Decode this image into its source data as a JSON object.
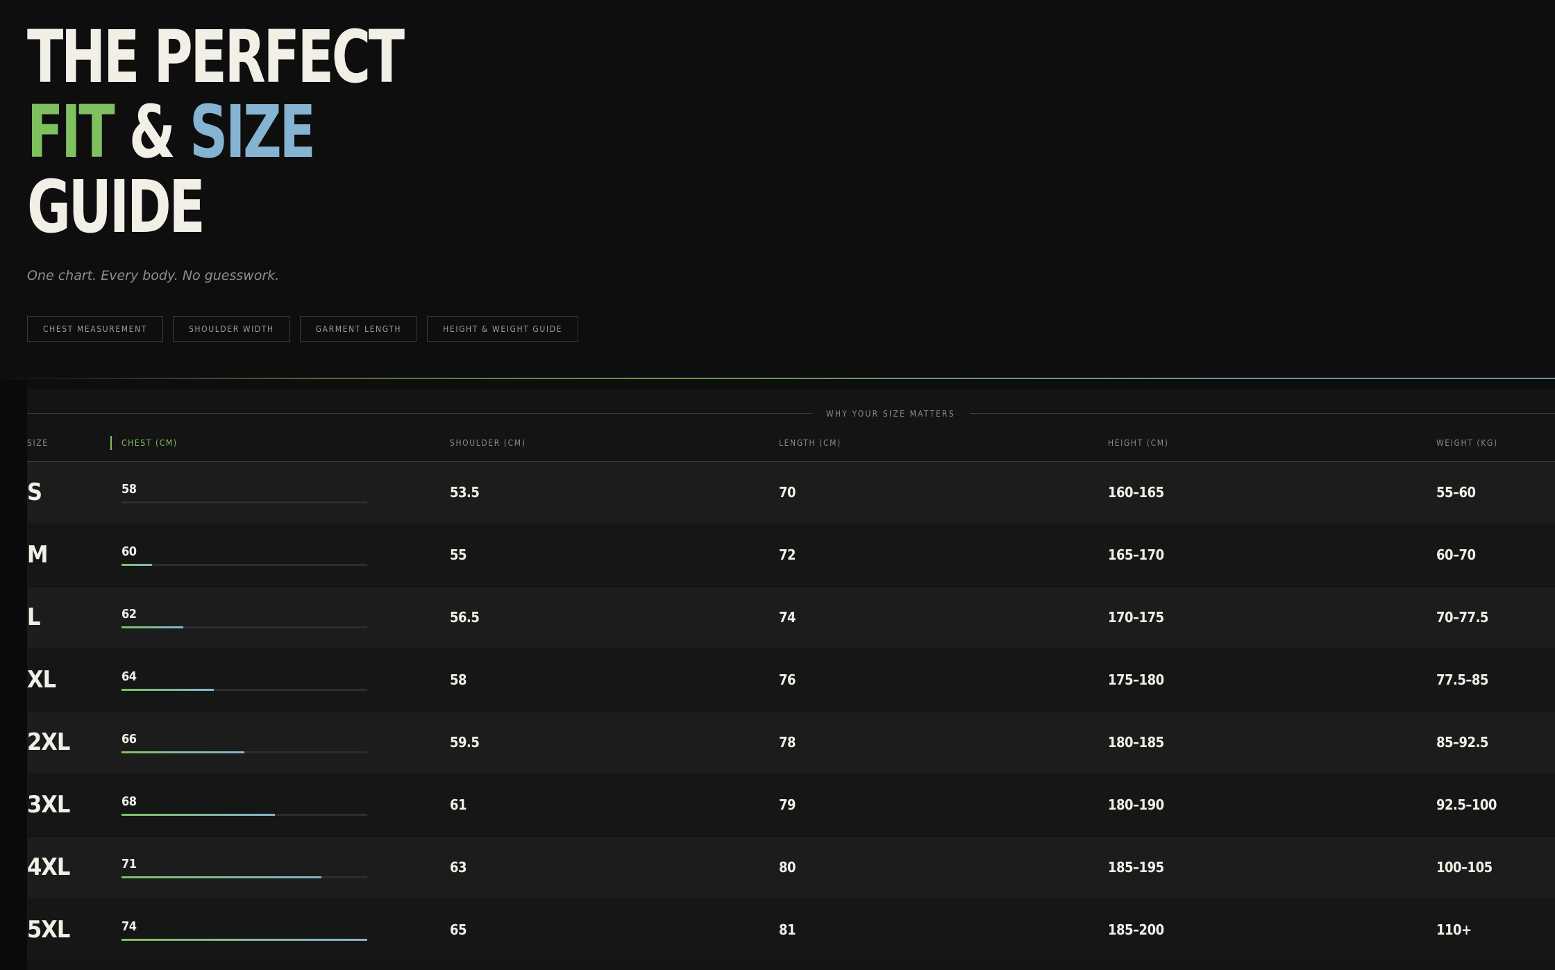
{
  "hero": {
    "line1": "THE PERFECT",
    "line2_fit": "FIT",
    "line2_amp": "&",
    "line2_size": "SIZE",
    "line3": "GUIDE",
    "tagline": "One chart. Every body. No guesswork."
  },
  "tags": [
    "CHEST MEASUREMENT",
    "SHOULDER WIDTH",
    "GARMENT LENGTH",
    "HEIGHT & WEIGHT GUIDE"
  ],
  "section_title": "WHY YOUR SIZE MATTERS",
  "table": {
    "headers": [
      "SIZE",
      "CHEST (CM)",
      "SHOULDER (CM)",
      "LENGTH (CM)",
      "HEIGHT (CM)",
      "WEIGHT (KG)"
    ],
    "rows": [
      {
        "size": "S",
        "chest": "58",
        "chest_fill": 0.0,
        "shoulder": "53.5",
        "length": "70",
        "height": "160–165",
        "weight": "55–60"
      },
      {
        "size": "M",
        "chest": "60",
        "chest_fill": 0.125,
        "shoulder": "55",
        "length": "72",
        "height": "165–170",
        "weight": "60–70"
      },
      {
        "size": "L",
        "chest": "62",
        "chest_fill": 0.25,
        "shoulder": "56.5",
        "length": "74",
        "height": "170–175",
        "weight": "70–77.5"
      },
      {
        "size": "XL",
        "chest": "64",
        "chest_fill": 0.375,
        "shoulder": "58",
        "length": "76",
        "height": "175–180",
        "weight": "77.5–85"
      },
      {
        "size": "2XL",
        "chest": "66",
        "chest_fill": 0.5,
        "shoulder": "59.5",
        "length": "78",
        "height": "180–185",
        "weight": "85–92.5"
      },
      {
        "size": "3XL",
        "chest": "68",
        "chest_fill": 0.625,
        "shoulder": "61",
        "length": "79",
        "height": "180–190",
        "weight": "92.5–100"
      },
      {
        "size": "4XL",
        "chest": "71",
        "chest_fill": 0.8125,
        "shoulder": "63",
        "length": "80",
        "height": "185–195",
        "weight": "100–105"
      },
      {
        "size": "5XL",
        "chest": "74",
        "chest_fill": 1.0,
        "shoulder": "65",
        "length": "81",
        "height": "185–200",
        "weight": "110+"
      }
    ]
  },
  "colors": {
    "accent_green": "#7fc160",
    "accent_blue": "#85b4d2",
    "background": "#0e0e0e"
  }
}
